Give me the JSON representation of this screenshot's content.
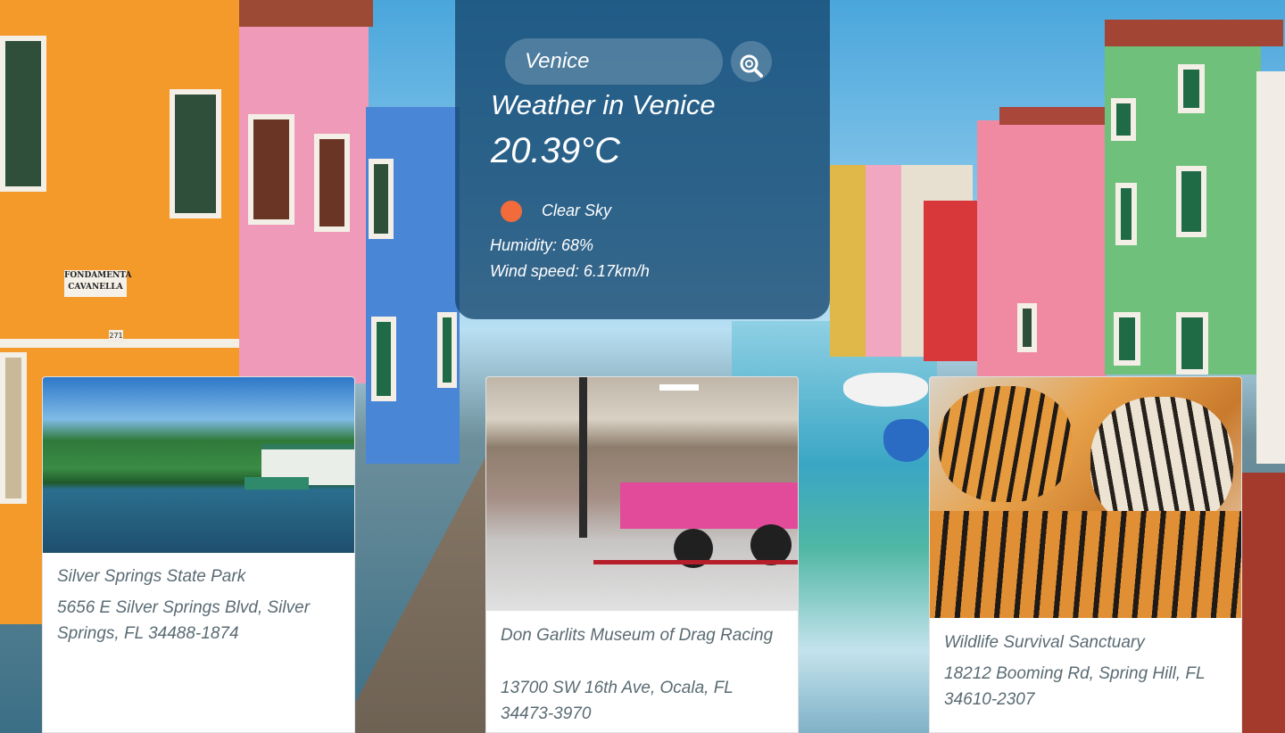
{
  "search": {
    "value": "Venice",
    "button_icon": "magnifier-icon"
  },
  "weather": {
    "title": "Weather in Venice",
    "temperature": "20.39°C",
    "condition": "Clear Sky",
    "condition_icon": "sun-icon",
    "humidity": "Humidity: 68%",
    "wind": "Wind speed: 6.17km/h"
  },
  "places": [
    {
      "name": "Silver Springs State Park",
      "address": "5656 E Silver Springs Blvd, Silver Springs, FL 34488-1874"
    },
    {
      "name": "Don Garlits Museum of Drag Racing",
      "address": "13700 SW 16th Ave, Ocala, FL 34473-3970"
    },
    {
      "name": "Wildlife Survival Sanctuary",
      "address": "18212 Booming Rd, Spring Hill, FL 34610-2307"
    }
  ],
  "background": {
    "sign_text": "FONDAMENTA CAVANELLA",
    "house_number": "271"
  },
  "colors": {
    "panel": "#14466e",
    "condition_icon": "#f26b3a",
    "card_text": "#5a6b73"
  }
}
